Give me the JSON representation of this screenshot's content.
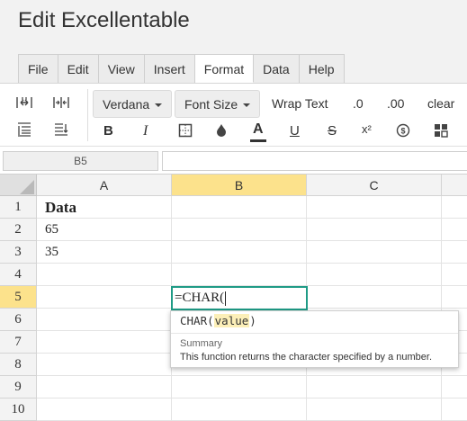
{
  "app": {
    "title": "Edit Excellentable"
  },
  "menu": {
    "tabs": [
      {
        "label": "File"
      },
      {
        "label": "Edit"
      },
      {
        "label": "View"
      },
      {
        "label": "Insert"
      },
      {
        "label": "Format",
        "active": true
      },
      {
        "label": "Data"
      },
      {
        "label": "Help"
      }
    ]
  },
  "toolbar": {
    "font_family": "Verdana",
    "font_size": "Font Size",
    "wrap_text": "Wrap Text",
    "decrease_decimals": ".0",
    "increase_decimals": ".00",
    "clear": "clear",
    "bold": "B",
    "italic": "I",
    "text_color": "A",
    "underline": "U",
    "strikethrough": "S",
    "superscript": "x²",
    "currency": "$",
    "icons": [
      "increase-column-width-icon",
      "decrease-column-width-icon",
      "increase-row-height-icon",
      "decrease-row-height-icon",
      "borders-icon",
      "fill-color-icon",
      "format-painter-icon"
    ],
    "text_color_swatch": "#333333"
  },
  "formula_bar": {
    "name_box": "B5",
    "formula": ""
  },
  "grid": {
    "columns": [
      "A",
      "B",
      "C"
    ],
    "rows": [
      "1",
      "2",
      "3",
      "4",
      "5",
      "6",
      "7",
      "8",
      "9",
      "10"
    ],
    "selected_column": "B",
    "selected_row": "5",
    "cells": {
      "A1": "Data",
      "A2": "65",
      "A3": "35"
    },
    "editing_value": "=CHAR(",
    "accent": "#1f9b86",
    "selection_header_color": "#fce28c"
  },
  "autocomplete": {
    "function_name": "CHAR(",
    "param": "value",
    "close": ")",
    "summary_label": "Summary",
    "summary_text": "This function returns the character specified by a number."
  }
}
